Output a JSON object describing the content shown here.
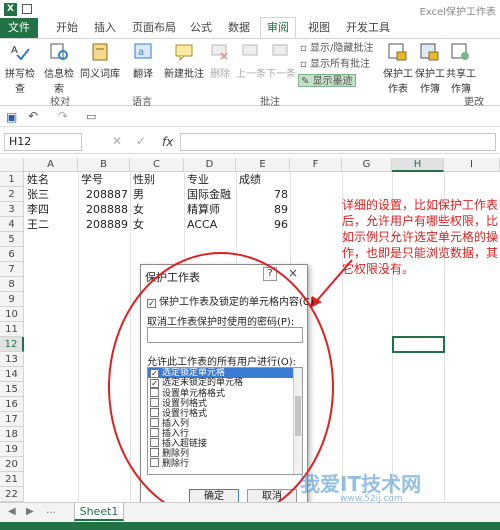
{
  "app": {
    "title": "Excel保护工作表"
  },
  "tabs": [
    "文件",
    "开始",
    "插入",
    "页面布局",
    "公式",
    "数据",
    "审阅",
    "视图",
    "开发工具"
  ],
  "ribbon": {
    "buttons": [
      "拼写检查",
      "信息检索",
      "同义词库",
      "翻译",
      "新建批注",
      "删除",
      "上一条",
      "下一条",
      "保护工作表",
      "保护工作簿",
      "共享工作簿"
    ],
    "comment_options": [
      "显示/隐藏批注",
      "显示所有批注",
      "显示墨迹"
    ],
    "groups": [
      "校对",
      "语言",
      "批注",
      "更改"
    ]
  },
  "namebox": "H12",
  "fx": "fx",
  "columns": [
    "A",
    "B",
    "C",
    "D",
    "E",
    "F",
    "G",
    "H",
    "I"
  ],
  "rows": [
    "1",
    "2",
    "3",
    "4",
    "5",
    "6",
    "7",
    "8",
    "9",
    "10",
    "11",
    "12",
    "13",
    "14",
    "15",
    "16",
    "17",
    "18",
    "19",
    "20",
    "21",
    "22"
  ],
  "table": {
    "headers": [
      "姓名",
      "学号",
      "性别",
      "专业",
      "成绩"
    ],
    "rows": [
      [
        "张三",
        "208887",
        "男",
        "国际金融",
        "78"
      ],
      [
        "李四",
        "208888",
        "女",
        "精算师",
        "89"
      ],
      [
        "王二",
        "208889",
        "女",
        "ACCA",
        "96"
      ]
    ]
  },
  "annotation": "详细的设置，比如保护工作表后，允许用户有哪些权限，比如示例只允许选定单元格的操作，也即是只能浏览数据，其它权限没有。",
  "dialog": {
    "title": "保护工作表",
    "help": "?",
    "close": "×",
    "protect_label": "保护工作表及锁定的单元格内容(C)",
    "password_label": "取消工作表保护时使用的密码(P):",
    "allow_label": "允许此工作表的所有用户进行(O):",
    "permissions": [
      {
        "label": "选定锁定单元格",
        "checked": true
      },
      {
        "label": "选定未锁定的单元格",
        "checked": true
      },
      {
        "label": "设置单元格格式",
        "checked": false
      },
      {
        "label": "设置列格式",
        "checked": false
      },
      {
        "label": "设置行格式",
        "checked": false
      },
      {
        "label": "插入列",
        "checked": false
      },
      {
        "label": "插入行",
        "checked": false
      },
      {
        "label": "插入超链接",
        "checked": false
      },
      {
        "label": "删除列",
        "checked": false
      },
      {
        "label": "删除行",
        "checked": false
      }
    ],
    "ok": "确定",
    "cancel": "取消"
  },
  "sheet_tab": "Sheet1",
  "watermark": {
    "text": "我爱IT技术网",
    "url": "www.52ij.com"
  }
}
